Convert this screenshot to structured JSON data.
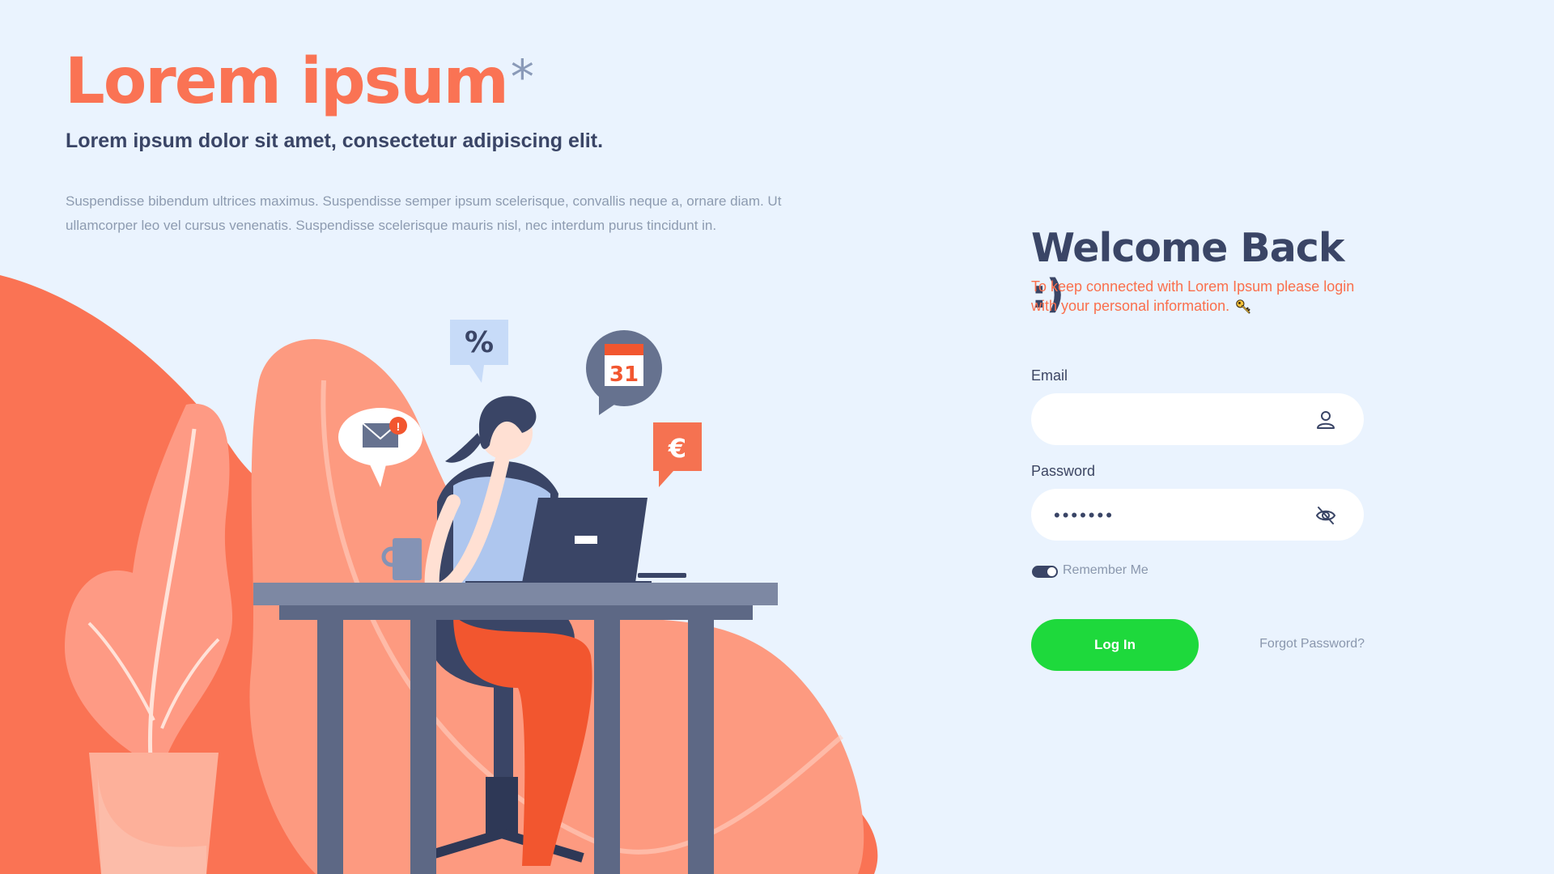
{
  "hero": {
    "title": "Lorem ipsum",
    "title_mark": "*",
    "subtitle": "Lorem ipsum dolor sit amet, consectetur adipiscing elit.",
    "paragraph": "Suspendisse bibendum ultrices maximus. Suspendisse semper ipsum scelerisque, convallis neque a, ornare diam. Ut ullamcorper leo vel cursus venenatis. Suspendisse scelerisque mauris nisl, nec interdum purus tincidunt in."
  },
  "illustration": {
    "percent_badge": "%",
    "calendar_day": "31",
    "currency_badge": "€"
  },
  "login": {
    "heading": "Welcome Back :)",
    "subheading": "To keep connected with Lorem Ipsum please login with your personal information.",
    "email_label": "Email",
    "email_value": "",
    "password_label": "Password",
    "password_value": "•••••••",
    "remember_label": "Remember Me",
    "remember_checked": true,
    "login_button": "Log In",
    "forgot_link": "Forgot Password?"
  },
  "colors": {
    "accent": "#fa7354",
    "heading": "#3a4566",
    "muted": "#8a97ad",
    "button": "#1ed93c",
    "background": "#eaf3fe"
  },
  "icons": [
    "user-icon",
    "eye-off-icon",
    "key-icon",
    "mail-icon",
    "calendar-icon",
    "euro-icon",
    "percent-icon"
  ]
}
